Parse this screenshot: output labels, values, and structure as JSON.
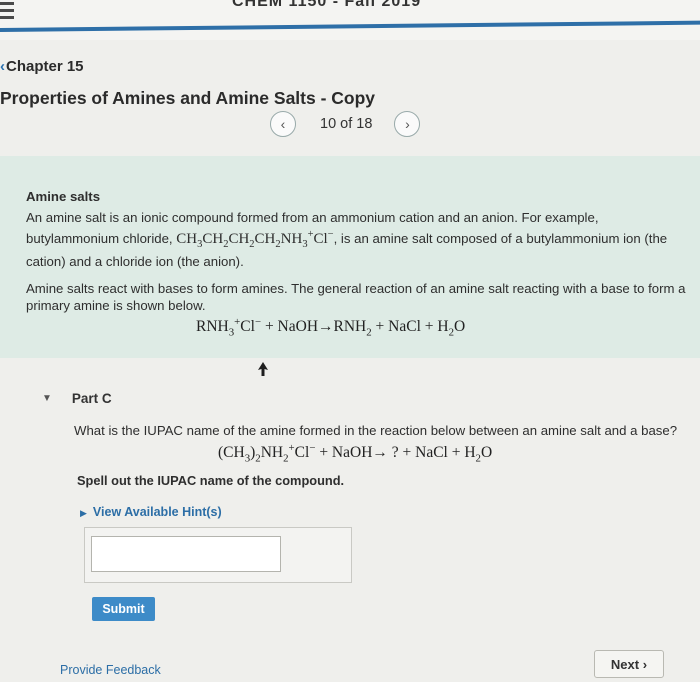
{
  "header": {
    "course_title": "CHEM 1150 - Fall 2019"
  },
  "nav": {
    "chapter_label": "Chapter 15",
    "page_title": "Properties of Amines and Amine Salts - Copy",
    "pager_text": "10 of 18"
  },
  "intro": {
    "heading": "Amine salts",
    "p1_a": "An amine salt is an ionic compound formed from an ammonium cation and an anion. For example, butylammonium chloride,",
    "p1_b": ", is an amine salt composed of a butylammonium ion (the cation) and a chloride ion (the anion).",
    "p2": "Amine salts react with bases to form amines. The general reaction of an amine salt reacting with a base to form a primary amine is shown below."
  },
  "part": {
    "label": "Part C",
    "question": "What is the IUPAC name of the amine formed in the reaction below between an amine salt and a base?",
    "instruction": "Spell out the IUPAC name of the compound.",
    "hints_label": "View Available Hint(s)",
    "answer_value": "",
    "submit_label": "Submit"
  },
  "footer": {
    "feedback_label": "Provide Feedback",
    "next_label": "Next"
  },
  "colors": {
    "accent": "#2e6fa8",
    "link": "#2c6ea6",
    "intro_bg": "#deebe5",
    "submit_bg": "#3d8bc8"
  }
}
